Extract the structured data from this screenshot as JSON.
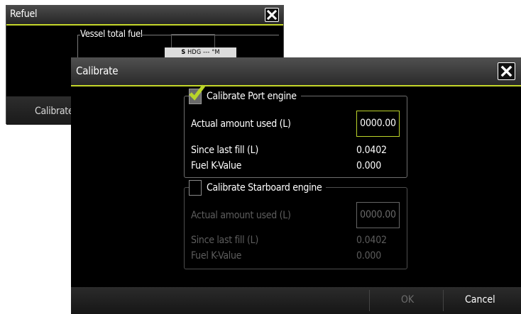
{
  "refuel_dialog": {
    "title": "Refuel",
    "section_label": "Vessel total fuel",
    "calibrate_label": "Calibrate"
  },
  "status_bar": {
    "direction": "S",
    "heading_text": "HDG --- °M"
  },
  "calibrate_dialog": {
    "title": "Calibrate",
    "port": {
      "label": "Calibrate Port engine",
      "checked": true,
      "actual_label": "Actual amount used (L)",
      "actual_value": "0000.00",
      "since_label": "Since last fill (L)",
      "since_value": "0.0402",
      "k_label": "Fuel K-Value",
      "k_value": "0.000"
    },
    "starboard": {
      "label": "Calibrate Starboard engine",
      "checked": false,
      "actual_label": "Actual amount used (L)",
      "actual_value": "0000.00",
      "since_label": "Since last fill (L)",
      "since_value": "0.0402",
      "k_label": "Fuel K-Value",
      "k_value": "0.000"
    },
    "ok_label": "OK",
    "cancel_label": "Cancel"
  },
  "colors": {
    "accent": "#c4d62a",
    "checkmark": "#b8d42a",
    "disabled_text": "#5d5d5d"
  }
}
